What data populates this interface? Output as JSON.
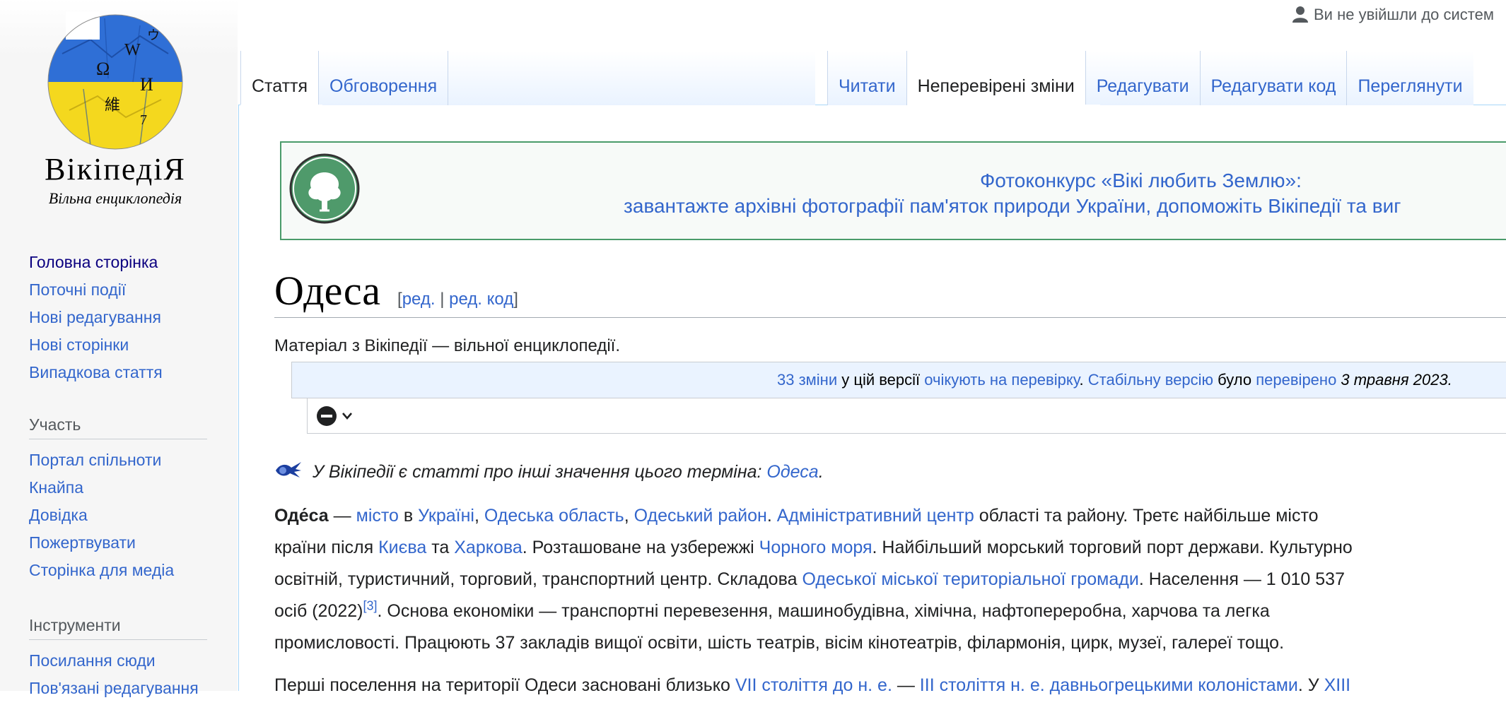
{
  "logo": {
    "wordmark": "ВікіпедіЯ",
    "tagline": "Вільна енциклопедія",
    "glyphs": [
      "Ω",
      "W",
      "И",
      "維",
      "ウ",
      "7"
    ],
    "colors": {
      "blue": "#2f6fd6",
      "yellow": "#f4d81e"
    }
  },
  "personal": {
    "text": "Ви не увійшли до систем"
  },
  "nav": {
    "main": [
      "Головна сторінка",
      "Поточні події",
      "Нові редагування",
      "Нові сторінки",
      "Випадкова стаття"
    ],
    "participation_head": "Участь",
    "participation": [
      "Портал спільноти",
      "Кнайпа",
      "Довідка",
      "Пожертвувати",
      "Сторінка для медіа"
    ],
    "tools_head": "Інструменти",
    "tools": [
      "Посилання сюди",
      "Пов'язані редагування"
    ]
  },
  "tabs": {
    "left": [
      "Стаття",
      "Обговорення"
    ],
    "right": [
      "Читати",
      "Неперевірені зміни",
      "Редагувати",
      "Редагувати код",
      "Переглянути"
    ]
  },
  "banner": {
    "line1": "Фотоконкурс «Вікі любить Землю»:",
    "line2": "завантажте архівні фотографії пам'яток природи України, допоможіть Вікіпедії та виг"
  },
  "heading": {
    "title": "Одеса",
    "edit_open": "[",
    "edit": "ред.",
    "separator": "|",
    "edit_code": "ред. код",
    "edit_close": "]"
  },
  "site_sub": "Матеріал з Вікіпедії — вільної енциклопедії.",
  "flagged": {
    "changes_link": "33 зміни",
    "text1": " у цій версії ",
    "pending_link": "очікують на перевірку",
    "text2": ". ",
    "stable_link": "Стабільну версію",
    "text3": " було ",
    "checked_link": "перевірено",
    "date": " 3 травня 2023."
  },
  "hatnote": {
    "text": "У Вікіпедії є статті про інші значення цього терміна: ",
    "link": "Одеса",
    "end": "."
  },
  "p1": {
    "l1": {
      "bold": "Оде́са",
      "t1": "  — ",
      "a1": "місто",
      "t2": " в ",
      "a2": "Україні",
      "t3": ", ",
      "a3": "Одеська область",
      "t4": ", ",
      "a4": "Одеський район",
      "t5": ". ",
      "a5": "Адміністративний центр",
      "t6": " області та району. Третє найбільше місто"
    },
    "l2": {
      "t1": "країни після ",
      "a1": "Києва",
      "t2": " та ",
      "a2": "Харкова",
      "t3": ". Розташоване на узбережжі ",
      "a3": "Чорного моря",
      "t4": ". Найбільший морський торговий порт держави. Культурно"
    },
    "l3": {
      "t1": "освітній, туристичний, торговий, транспортний центр. Складова ",
      "a1": "Одеської міської територіальної громади",
      "t2": ". Населення — 1 010 537"
    },
    "l4": {
      "t1": "осіб (2022)",
      "sup": "[3]",
      "t2": ". Основа економіки — транспортні перевезення, машинобудівна, хімічна, нафтопереробна, харчова та легка"
    },
    "l5": {
      "t1": "промисловості. Працюють 37 закладів вищої освіти, шість театрів, вісім кінотеатрів, філармонія, цирк, музеї, галереї тощо."
    }
  },
  "p2": {
    "t1": "Перші поселення на території Одеси засновані близько ",
    "a1": "VII століття до н. е.",
    "t2": " — ",
    "a2": "III століття н. е.",
    "t3": " ",
    "a3": "давньогрецькими колоністами",
    "t4": ". У ",
    "a4": "XIII"
  }
}
